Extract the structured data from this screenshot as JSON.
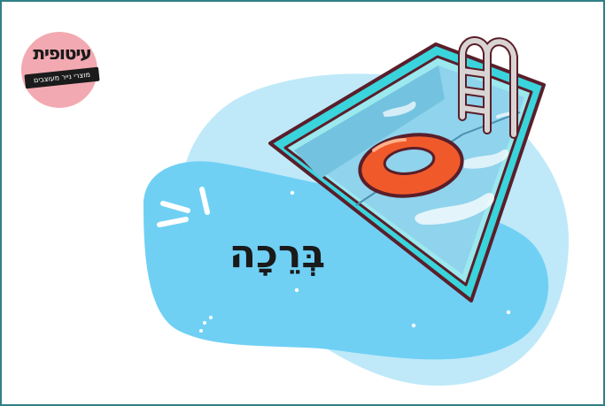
{
  "logo": {
    "title": "עיטופית",
    "subtitle": "מוצרי נייר מעוצבים"
  },
  "card": {
    "word": "בְּרֵכָה",
    "illustration": "swimming-pool"
  },
  "colors": {
    "border": "#2f7f86",
    "blob_light": "#bfe9f8",
    "blob_main": "#6fd0f4",
    "pool_rim": "#3ad4dc",
    "pool_outline": "#5a1e2a",
    "water": "#8fd3ec",
    "float_ring": "#f05a2a",
    "ladder": "#d9d4d4",
    "logo_pink": "#f3a9b1"
  }
}
